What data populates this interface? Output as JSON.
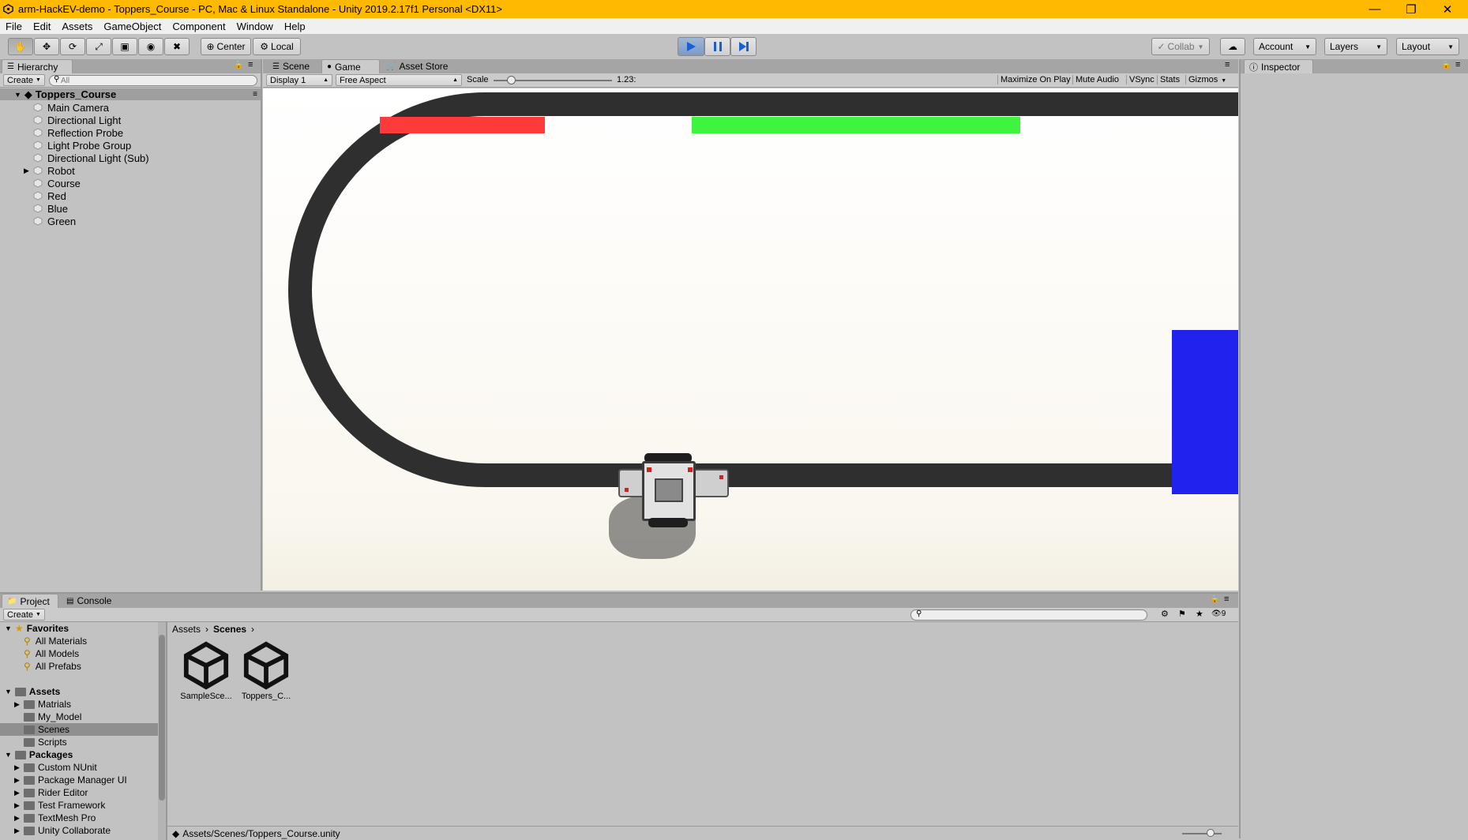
{
  "window": {
    "title": "arm-HackEV-demo - Toppers_Course - PC, Mac & Linux Standalone - Unity 2019.2.17f1 Personal <DX11>"
  },
  "menu": [
    "File",
    "Edit",
    "Assets",
    "GameObject",
    "Component",
    "Window",
    "Help"
  ],
  "toolbar": {
    "pivot": "Center",
    "space": "Local",
    "collab": "Collab",
    "account": "Account",
    "layers": "Layers",
    "layout": "Layout"
  },
  "hierarchy": {
    "tab": "Hierarchy",
    "create": "Create",
    "search_placeholder": "All",
    "scene": "Toppers_Course",
    "items": [
      "Main Camera",
      "Directional Light",
      "Reflection Probe",
      "Light Probe Group",
      "Directional Light (Sub)",
      "Robot",
      "Course",
      "Red",
      "Blue",
      "Green"
    ]
  },
  "center_tabs": {
    "scene": "Scene",
    "game": "Game",
    "asset_store": "Asset Store"
  },
  "game_bar": {
    "display": "Display 1",
    "aspect": "Free Aspect",
    "scale_label": "Scale",
    "scale_value": "1.23:",
    "maximize": "Maximize On Play",
    "mute": "Mute Audio",
    "vsync": "VSync",
    "stats": "Stats",
    "gizmos": "Gizmos"
  },
  "inspector": {
    "tab": "Inspector"
  },
  "project": {
    "tab": "Project",
    "console_tab": "Console",
    "create": "Create",
    "hidden_count": "9",
    "favorites": {
      "label": "Favorites",
      "items": [
        "All Materials",
        "All Models",
        "All Prefabs"
      ]
    },
    "assets": {
      "label": "Assets",
      "items": [
        "Matrials",
        "My_Model",
        "Scenes",
        "Scripts"
      ]
    },
    "packages": {
      "label": "Packages",
      "items": [
        "Custom NUnit",
        "Package Manager UI",
        "Rider Editor",
        "Test Framework",
        "TextMesh Pro",
        "Unity Collaborate"
      ]
    },
    "breadcrumb": [
      "Assets",
      "Scenes"
    ],
    "files": [
      "SampleSce...",
      "Toppers_C..."
    ],
    "status_path": "Assets/Scenes/Toppers_Course.unity"
  },
  "colors": {
    "title_bar": "#ffba00",
    "red_marker": "#ff3a3a",
    "green_marker": "#3ef43e",
    "blue_marker": "#2222ee",
    "track": "#2f2f2f"
  }
}
